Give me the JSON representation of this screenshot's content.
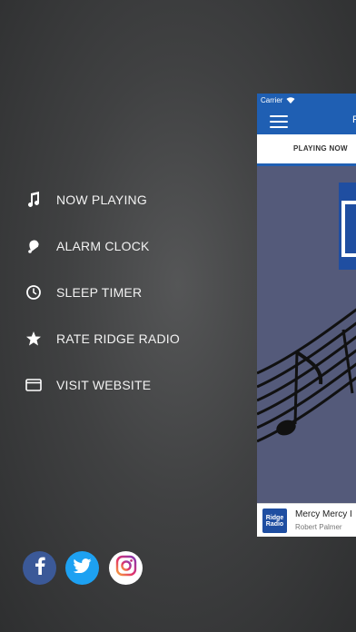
{
  "menu": {
    "items": [
      {
        "label": "NOW PLAYING",
        "icon": "music-note-icon"
      },
      {
        "label": "ALARM CLOCK",
        "icon": "alarm-bell-icon"
      },
      {
        "label": "SLEEP TIMER",
        "icon": "clock-icon"
      },
      {
        "label": "RATE RIDGE RADIO",
        "icon": "star-icon"
      },
      {
        "label": "VISIT WEBSITE",
        "icon": "browser-window-icon"
      }
    ]
  },
  "social": [
    {
      "name": "facebook-icon",
      "color": "#3b5998"
    },
    {
      "name": "twitter-icon",
      "color": "#1da1f2"
    },
    {
      "name": "instagram-icon",
      "color": "#ffffff"
    }
  ],
  "phone": {
    "carrier": "Carrier",
    "title": "F",
    "tab": "PLAYING NOW",
    "now_playing": {
      "song": "Mercy Mercy I",
      "artist": "Robert Palmer",
      "logo_line1": "Ridge",
      "logo_line2": "Radio"
    }
  },
  "colors": {
    "accent": "#1f5fb3",
    "artwork_bg": "#545a7a"
  }
}
